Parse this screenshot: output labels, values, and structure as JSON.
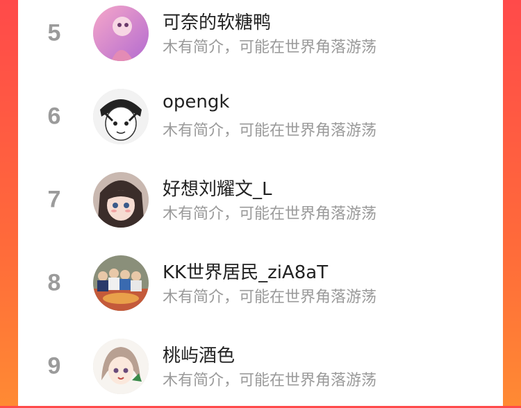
{
  "users": [
    {
      "rank": "5",
      "name": "可奈的软糖鸭",
      "bio": "木有简介，可能在世界角落游荡"
    },
    {
      "rank": "6",
      "name": "opengk",
      "bio": "木有简介，可能在世界角落游荡"
    },
    {
      "rank": "7",
      "name": "好想刘耀文_L",
      "bio": "木有简介，可能在世界角落游荡"
    },
    {
      "rank": "8",
      "name": "KK世界居民_ziA8aT",
      "bio": "木有简介，可能在世界角落游荡"
    },
    {
      "rank": "9",
      "name": "桃屿酒色",
      "bio": "木有简介，可能在世界角落游荡"
    }
  ],
  "colors": {
    "background_gradient_top": "#ff4a4a",
    "background_gradient_bottom": "#ff8a33",
    "rank_color": "#9b9b9b",
    "name_color": "#222222",
    "bio_color": "#9a9a9a"
  }
}
